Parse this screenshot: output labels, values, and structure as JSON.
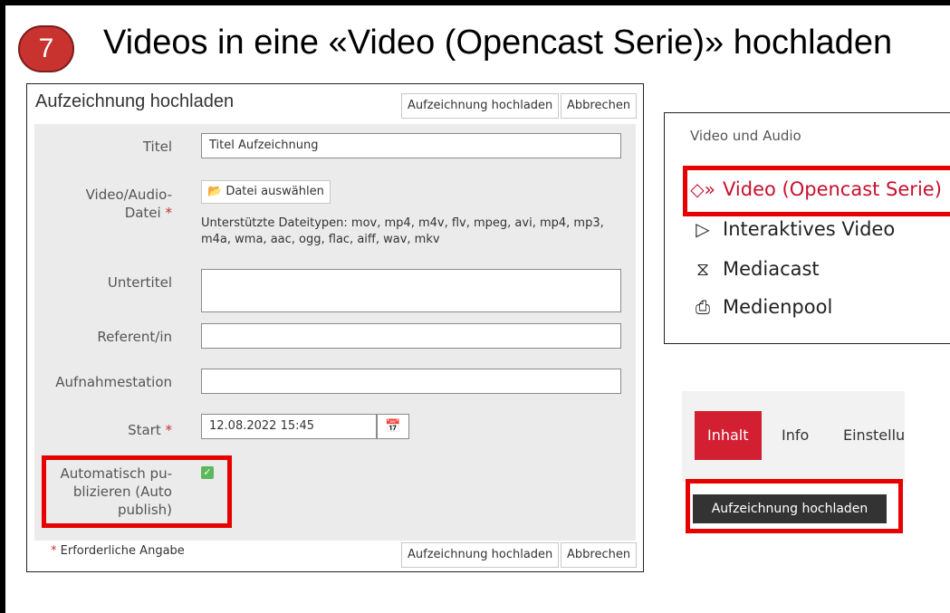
{
  "slide": {
    "step_number": "7",
    "title": "Videos in eine «Video (Opencast Serie)» hochladen"
  },
  "form": {
    "title": "Aufzeichnung hochladen",
    "upload_label": "Aufzeichnung hochladen",
    "cancel_label": "Abbrechen",
    "fields": {
      "titel_label": "Titel",
      "titel_value": "Titel Aufzeichnung",
      "datei_label_1": "Video/Audio-",
      "datei_label_2": "Datei",
      "datei_button": "Datei auswählen",
      "datei_hint_1": "Unterstützte Dateitypen: mov, mp4, m4v, flv, mpeg, avi, mp4, mp3,",
      "datei_hint_2": "m4a, wma, aac, ogg, flac, aiff, wav, mkv",
      "untertitel_label": "Untertitel",
      "untertitel_value": "",
      "referent_label": "Referent/in",
      "referent_value": "",
      "aufnahme_label": "Aufnahmestation",
      "aufnahme_value": "",
      "start_label": "Start",
      "start_value": "12.08.2022 15:45",
      "auto_label_1": "Automatisch pu-",
      "auto_label_2": "blizieren (Auto",
      "auto_label_3": "publish)",
      "auto_checked": true
    },
    "required_asterisk": "*",
    "required_note": "Erforderliche Angabe"
  },
  "menu": {
    "heading": "Video und Audio",
    "items": [
      {
        "label": "Video (Opencast Serie)",
        "icon": "opencast-icon"
      },
      {
        "label": "Interaktives Video",
        "icon": "interactive-video-icon"
      },
      {
        "label": "Mediacast",
        "icon": "broadcast-icon"
      },
      {
        "label": "Medienpool",
        "icon": "media-pool-icon"
      }
    ]
  },
  "tabs": {
    "items": [
      "Inhalt",
      "Info",
      "Einstellu"
    ],
    "active": "Inhalt",
    "upload_button": "Aufzeichnung hochladen"
  },
  "colors": {
    "accent_red": "#d31f32",
    "highlight_red": "#e60000",
    "badge_red": "#c8322f"
  }
}
